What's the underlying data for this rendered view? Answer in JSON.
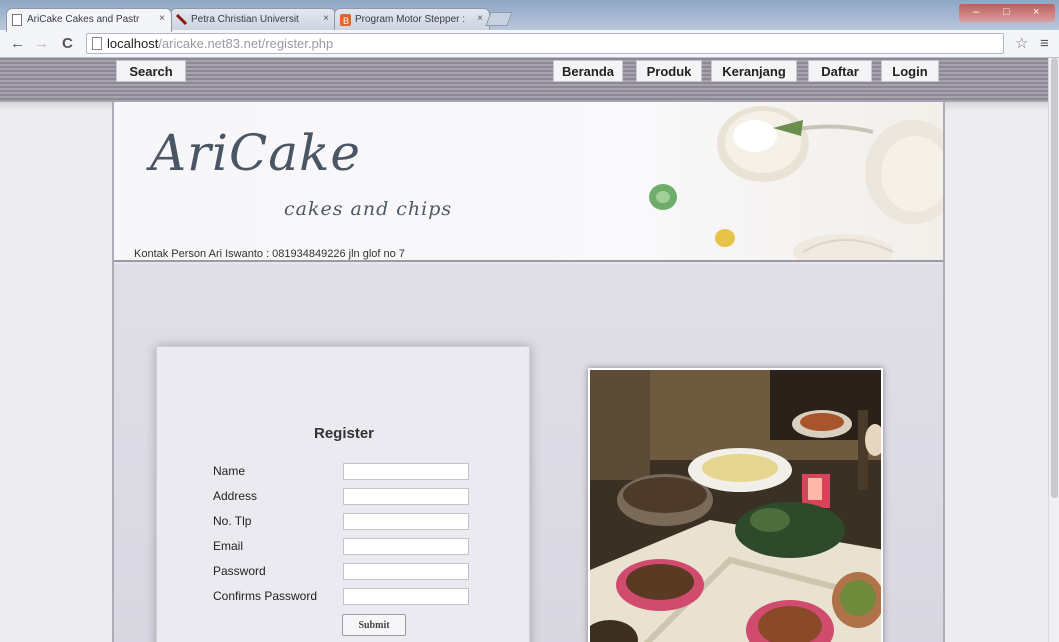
{
  "browser": {
    "tabs": [
      {
        "label": "AriCake Cakes and Pastr",
        "active": true
      },
      {
        "label": "Petra Christian Universit",
        "active": false
      },
      {
        "label": "Program Motor Stepper :",
        "active": false
      }
    ],
    "tab_close": "×",
    "url_host": "localhost",
    "url_path": "/aricake.net83.net/register.php",
    "back": "←",
    "forward": "→",
    "reload": "C",
    "star": "☆",
    "menu": "≡",
    "window_buttons": {
      "minimize": "–",
      "maximize": "□",
      "close": "×"
    }
  },
  "nav": {
    "search": "Search",
    "items": [
      "Beranda",
      "Produk",
      "Keranjang",
      "Daftar",
      "Login"
    ]
  },
  "header": {
    "logo": "AriCake",
    "tagline": "cakes and chips",
    "contact": "Kontak Person Ari Iswanto : 081934849226 jln glof no 7"
  },
  "register": {
    "title": "Register",
    "fields": [
      {
        "label": "Name",
        "value": ""
      },
      {
        "label": "Address",
        "value": ""
      },
      {
        "label": "No. Tlp",
        "value": ""
      },
      {
        "label": "Email",
        "value": ""
      },
      {
        "label": "Password",
        "value": ""
      },
      {
        "label": "Confirms Password",
        "value": ""
      }
    ],
    "submit": "Submit"
  },
  "colors": {
    "nav_strip": "#8c8995",
    "logo": "#4a5664",
    "page_bg": "#e6e5ec"
  }
}
